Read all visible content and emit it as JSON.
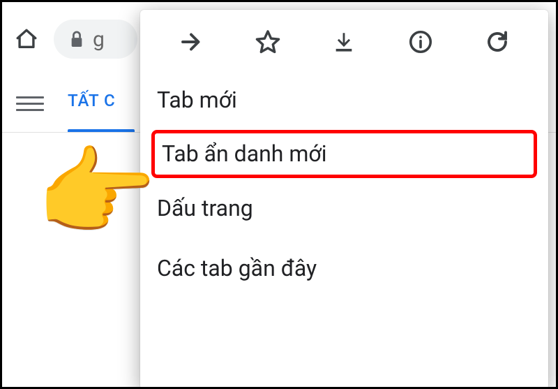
{
  "toolbar": {
    "address_fragment": "g"
  },
  "tabs": {
    "active_label": "TẤT C"
  },
  "menu": {
    "items": [
      {
        "label": "Tab mới"
      },
      {
        "label": "Tab ẩn danh mới"
      },
      {
        "label": "Dấu trang"
      },
      {
        "label": "Các tab gần đây"
      }
    ]
  }
}
